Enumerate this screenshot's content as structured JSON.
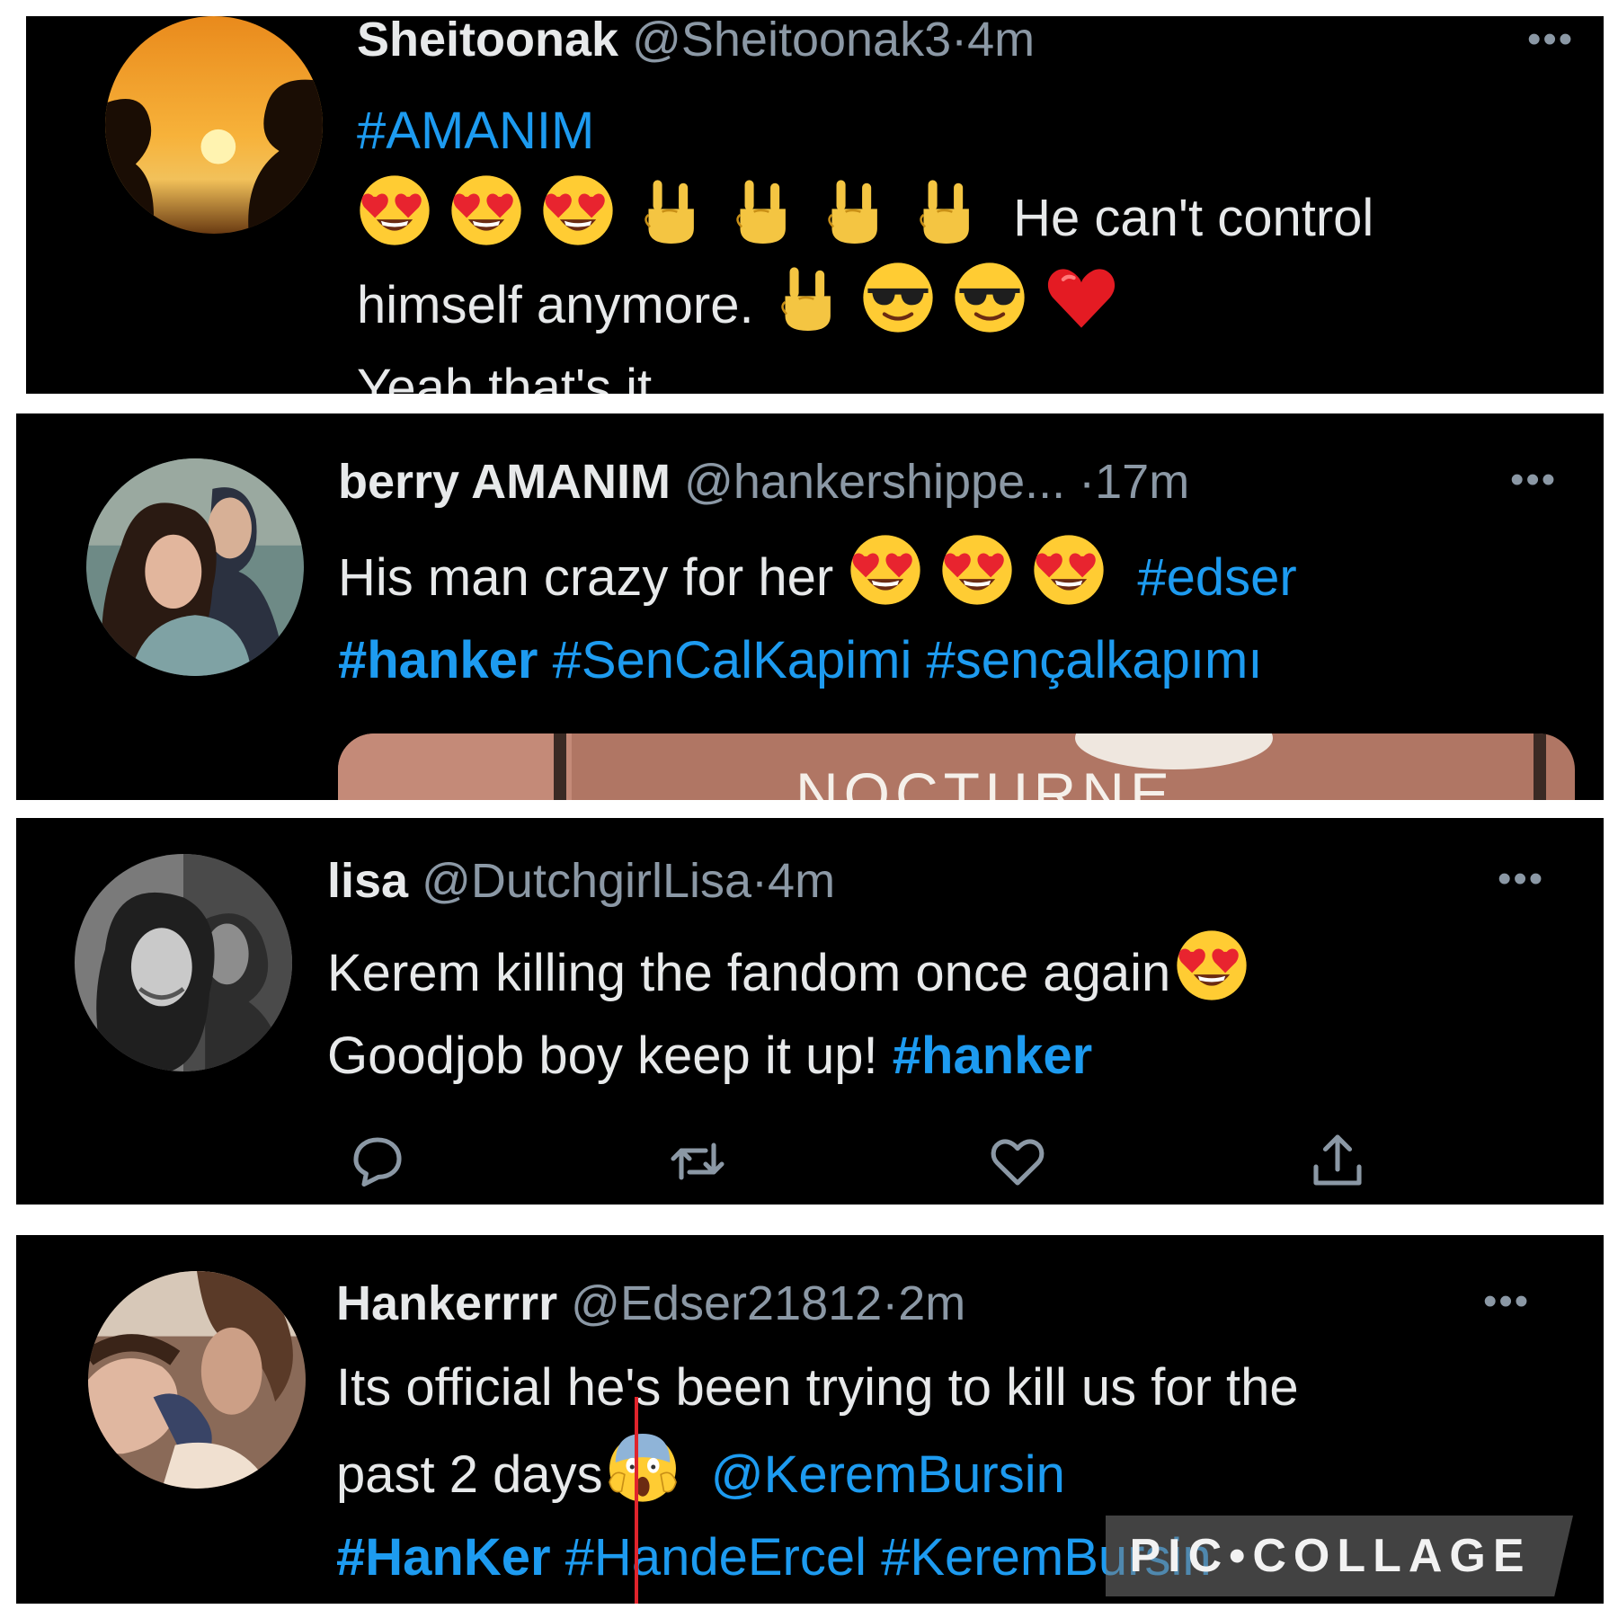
{
  "tweets": [
    {
      "name": "Sheitoonak",
      "handle": "@Sheitoonak3",
      "time": "4m",
      "hashtag": "#AMANIM",
      "text1": "He can't control",
      "text2": "himself anymore.",
      "text3": "Yeah that's it"
    },
    {
      "name": "berry AMANIM",
      "handle": "@hankershippe...",
      "time": "17m",
      "text1": "His man crazy for her",
      "tag1": "#edser",
      "tag2": "#hanker",
      "tag3": "#SenCalKapimi",
      "tag4": "#sençalkapımı",
      "media_text": "NOCTURNE"
    },
    {
      "name": "lisa",
      "handle": "@DutchgirlLisa",
      "time": "4m",
      "text1": "Kerem killing the fandom once again",
      "text2": "Goodjob boy keep it up!",
      "tag1": "#hanker"
    },
    {
      "name": "Hankerrrr",
      "handle": "@Edser21812",
      "time": "2m",
      "text1": "Its official he's been trying to kill us for the",
      "text2": "past 2 days",
      "mention": "@KeremBursin",
      "tag1": "#HanKer",
      "tag2": "#HandeErcel",
      "tag3": "#KeremBursin"
    }
  ],
  "separator": "·",
  "more_glyph": "•••",
  "watermark": "PIC•COLLAGE",
  "icons": {
    "emoji": [
      "heart-eyes",
      "rock-on",
      "sunglasses",
      "red-heart",
      "screaming-face"
    ],
    "actions": [
      "reply-icon",
      "retweet-icon",
      "like-icon",
      "share-icon"
    ]
  },
  "colors": {
    "background": "#000000",
    "text": "#e7e9ea",
    "secondary": "#8b98a5",
    "link": "#1d9bf0",
    "collage_border": "#ffffff"
  }
}
